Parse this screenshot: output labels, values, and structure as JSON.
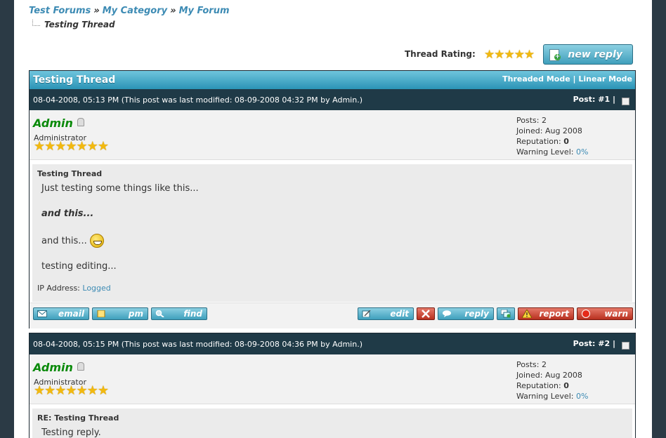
{
  "breadcrumb": {
    "items": [
      "Test Forums",
      "My Category",
      "My Forum"
    ],
    "separator": "»",
    "current": "Testing Thread"
  },
  "thread_rating": {
    "label": "Thread Rating:",
    "stars": "★★★★★"
  },
  "new_reply_label": "new reply",
  "thread": {
    "title": "Testing Thread",
    "mode_threaded": "Threaded Mode",
    "mode_sep": "|",
    "mode_linear": "Linear Mode"
  },
  "posts": [
    {
      "date": "08-04-2008, 05:13 PM (This post was last modified: 08-09-2008 04:32 PM by Admin.)",
      "number": "Post: #1",
      "pipe": "|",
      "author": "Admin",
      "role": "Administrator",
      "rank_stars": "★★★★★★★",
      "stats": {
        "posts": "Posts: 2",
        "joined": "Joined: Aug 2008",
        "rep_label": "Reputation: ",
        "rep_value": "0",
        "warn_label": "Warning Level: ",
        "warn_value": "0%"
      },
      "subject": "Testing Thread",
      "lines": [
        "Just testing some things like this...",
        "and this...",
        "and this...",
        "testing editing..."
      ],
      "ip_label": "IP Address: ",
      "ip_value": "Logged"
    },
    {
      "date": "08-04-2008, 05:15 PM (This post was last modified: 08-09-2008 04:36 PM by Admin.)",
      "number": "Post: #2",
      "pipe": "|",
      "author": "Admin",
      "role": "Administrator",
      "rank_stars": "★★★★★★★",
      "stats": {
        "posts": "Posts: 2",
        "joined": "Joined: Aug 2008",
        "rep_label": "Reputation: ",
        "rep_value": "0",
        "warn_label": "Warning Level: ",
        "warn_value": "0%"
      },
      "subject": "RE: Testing Thread",
      "lines": [
        "Testing reply."
      ]
    }
  ],
  "post_buttons": {
    "email": "email",
    "pm": "pm",
    "find": "find",
    "edit": "edit",
    "reply": "reply",
    "report": "report",
    "warn": "warn"
  },
  "colors": {
    "accent": "#3d8bb4",
    "header_dark": "#1f3a47",
    "author_green": "#0a8a0a",
    "star": "#f2b90f"
  },
  "icons": [
    "online-status-icon",
    "envelope-icon",
    "note-icon",
    "magnifier-icon",
    "edit-icon",
    "delete-x-icon",
    "speech-bubble-icon",
    "multiquote-icon",
    "warning-triangle-icon",
    "red-circle-icon",
    "grin-smiley-icon"
  ]
}
